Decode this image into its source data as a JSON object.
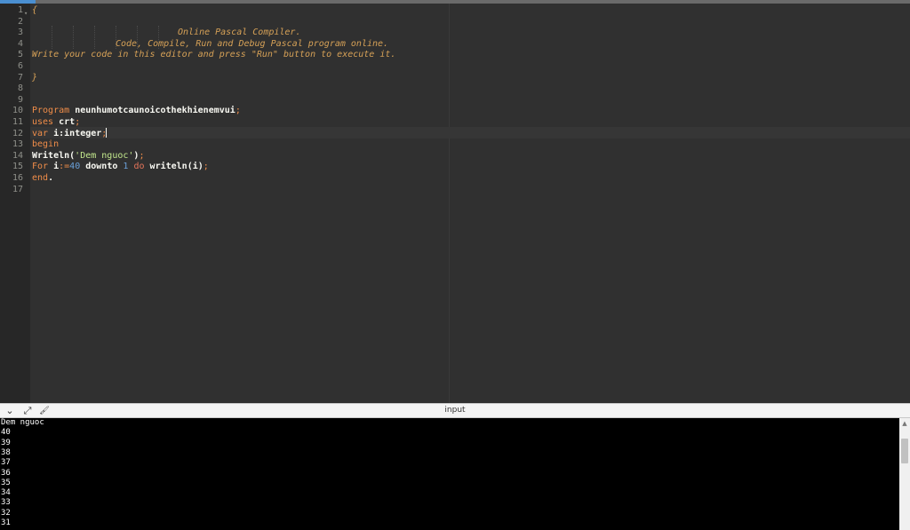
{
  "editor": {
    "line_numbers": [
      "1",
      "2",
      "3",
      "4",
      "5",
      "6",
      "7",
      "8",
      "9",
      "10",
      "11",
      "12",
      "13",
      "14",
      "15",
      "16",
      "17"
    ],
    "lines": {
      "l1": {
        "open_brace": "{"
      },
      "l3": {
        "comment": "Online Pascal Compiler."
      },
      "l4": {
        "comment": "Code, Compile, Run and Debug Pascal program online."
      },
      "l5": {
        "comment": "Write your code in this editor and press \"Run\" button to execute it."
      },
      "l7": {
        "close_brace": "}"
      },
      "l10": {
        "kw": "Program",
        "name": "neunhumotcaunoicothekhienemvui",
        "semi": ";"
      },
      "l11": {
        "kw": "uses",
        "name": "crt",
        "semi": ";"
      },
      "l12": {
        "kw": "var",
        "name": "i:integer",
        "semi": ";"
      },
      "l13": {
        "kw": "begin"
      },
      "l14": {
        "fn": "Writeln(",
        "str": "'Dem nguoc'",
        "close": ")",
        "semi": ";"
      },
      "l15": {
        "kw": "For",
        "var": "i",
        "assign": ":=",
        "start": "40",
        "downto": "downto",
        "end_val": "1",
        "do": "do",
        "call": "writeln(i)",
        "semi": ";"
      },
      "l16": {
        "kw": "end",
        "dot": "."
      }
    }
  },
  "panel": {
    "title": "input",
    "icons": [
      "chevron-down-icon",
      "expand-icon",
      "clear-icon"
    ],
    "collapse_glyph": "⌄",
    "expand_glyph": "⤢",
    "clear_glyph": "🖌"
  },
  "console": {
    "output": [
      "Dem nguoc",
      "40",
      "39",
      "38",
      "37",
      "36",
      "35",
      "34",
      "33",
      "32",
      "31"
    ]
  }
}
